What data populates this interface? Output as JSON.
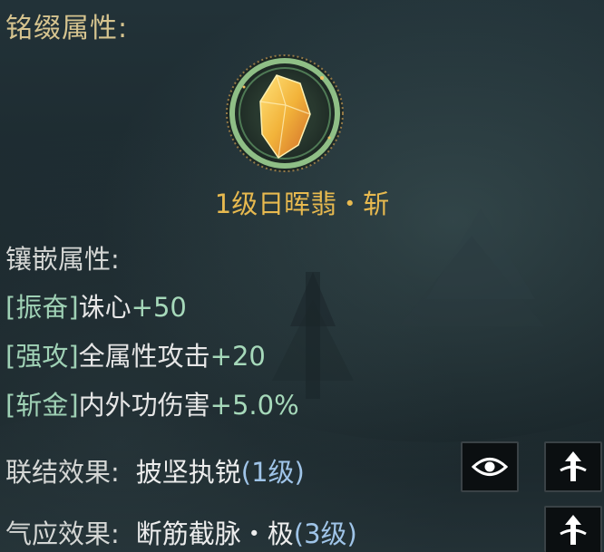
{
  "inscription": {
    "title": "铭缀属性:"
  },
  "gem": {
    "name": "1级日晖翡・斩",
    "icon": "amber-crystal-icon",
    "ring_color": "#8fbf86",
    "gem_color": "#f2b33a"
  },
  "inlay": {
    "heading": "镶嵌属性:",
    "attributes": [
      {
        "tag": "[振奋]",
        "stat": "诛心",
        "value": "+50"
      },
      {
        "tag": "[强攻]",
        "stat": "全属性攻击",
        "value": "+20"
      },
      {
        "tag": "[斩金]",
        "stat": "内外功伤害",
        "value": "+5.0%"
      }
    ]
  },
  "effects": {
    "link": {
      "label": "联结效果:",
      "name": "披坚执锐",
      "level": "(1级)"
    },
    "resonance": {
      "label": "气应效果:",
      "name": "断筋截脉・极",
      "level": "(3级)"
    }
  },
  "buttons": {
    "preview_icon": "eye-icon",
    "upgrade_icon": "upgrade-arrow-icon"
  }
}
